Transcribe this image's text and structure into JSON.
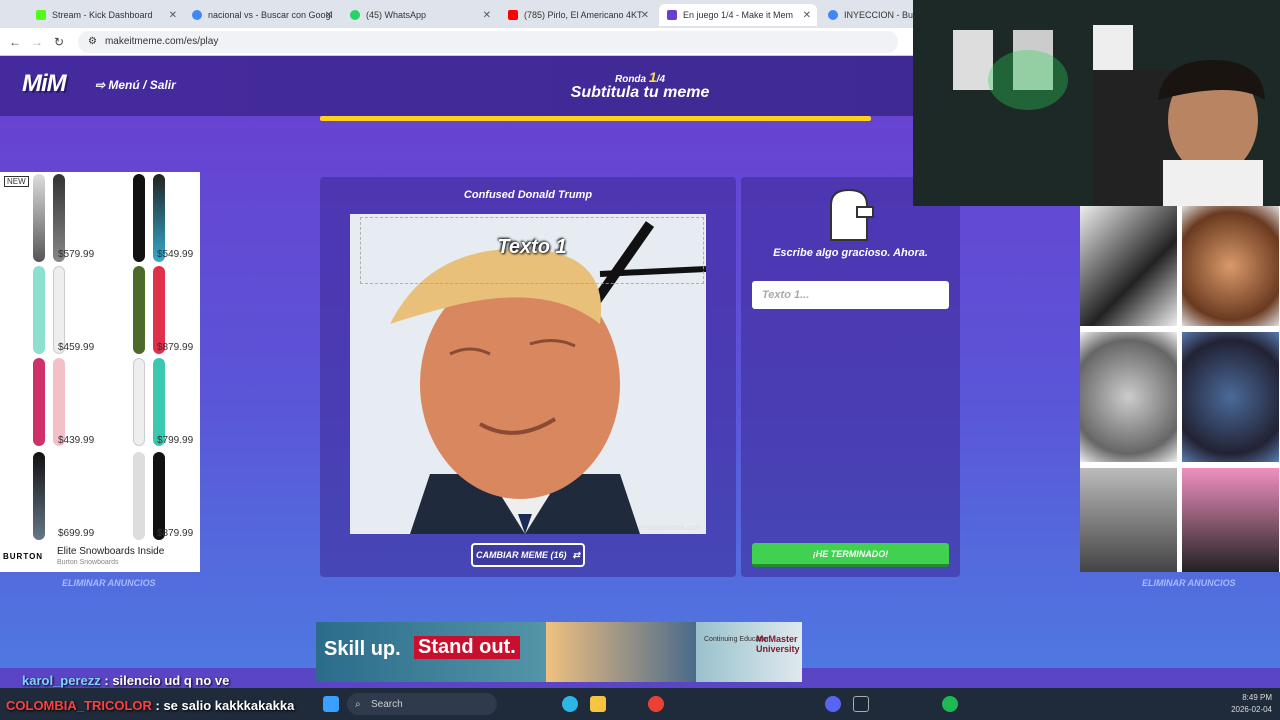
{
  "browser": {
    "tabs": [
      {
        "label": "Stream - Kick Dashboard",
        "color": "#53fc18",
        "active": false
      },
      {
        "label": "nacional vs - Buscar con Googl",
        "color": "#4285f4",
        "active": false
      },
      {
        "label": "(45) WhatsApp",
        "color": "#25d366",
        "active": false
      },
      {
        "label": "(785) Pirlo, El Americano 4KT",
        "color": "#ff0000",
        "active": false
      },
      {
        "label": "En juego 1/4 - Make it Mem",
        "color": "#6a3fd0",
        "active": true
      },
      {
        "label": "INYECCION - Buscar",
        "color": "#4285f4",
        "active": false
      }
    ],
    "url": "makeitmeme.com/es/play"
  },
  "header": {
    "logo": "MiM",
    "menu": "⇨ Menú / Salir",
    "ronda_label": "Ronda",
    "ronda_current": "1",
    "ronda_total": "/4",
    "subtitle": "Subtitula tu meme"
  },
  "meme": {
    "name": "Confused Donald Trump",
    "text1": "Texto 1",
    "watermark": "makeitmeme.com",
    "change_button": "CAMBIAR MEME (16)"
  },
  "side": {
    "prompt": "Escribe algo gracioso. Ahora.",
    "input_placeholder": "Texto 1...",
    "done_button": "¡HE TERMINADO!"
  },
  "ads": {
    "new_badge": "NEW",
    "prices": [
      "$579.99",
      "$549.99",
      "$459.99",
      "$879.99",
      "$439.99",
      "$799.99",
      "$699.99",
      "$879.99"
    ],
    "brand": "BURTON",
    "title": "Elite Snowboards Inside",
    "subtitle": "Burton Snowboards",
    "remove_left": "ELIMINAR ANUNCIOS",
    "remove_right": "ELIMINAR ANUNCIOS",
    "banner_skill": "Skill up.",
    "banner_standout": "Stand out.",
    "banner_cont": "Continuing Education",
    "banner_school": "McMaster University"
  },
  "chat": [
    {
      "user": "karol_perezz",
      "message": ": silencio ud q no ve"
    },
    {
      "user": "COLOMBIA_TRICOLOR",
      "message": ": se salio kakkkakakka"
    }
  ],
  "taskbar": {
    "search": "Search",
    "time": "8:49 PM",
    "date": "2026-02-04"
  }
}
